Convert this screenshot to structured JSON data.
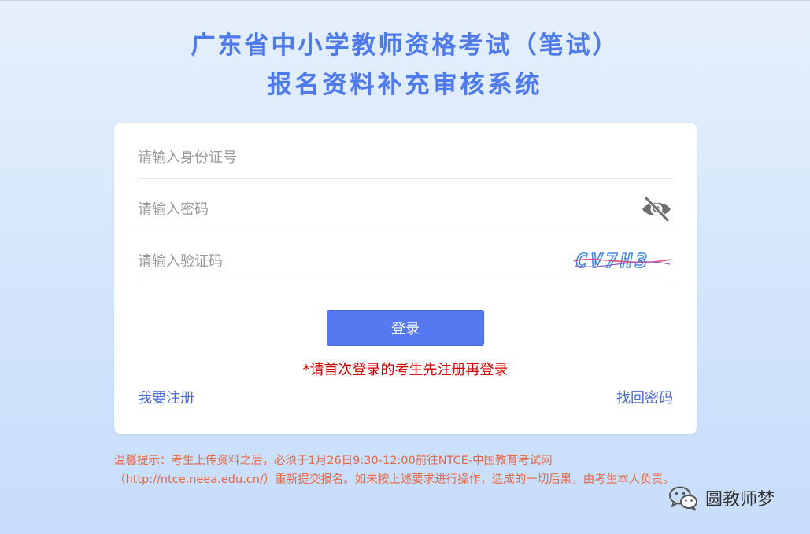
{
  "title": {
    "line1": "广东省中小学教师资格考试（笔试）",
    "line2": "报名资料补充审核系统"
  },
  "form": {
    "id_placeholder": "请输入身份证号",
    "password_placeholder": "请输入密码",
    "captcha_placeholder": "请输入验证码",
    "captcha_text": "CV7H3",
    "login_label": "登录",
    "notice": "*请首次登录的考生先注册再登录",
    "register_label": "我要注册",
    "recover_label": "找回密码"
  },
  "tip": {
    "prefix": "温馨提示：考生上传资料之后，必须于1月26日9:30-12:00前往NTCE-中国教育考试网（",
    "url": "http://ntce.neea.edu.cn/",
    "suffix": "）重新提交报名。如未按上述要求进行操作，造成的一切后果，由考生本人负责。"
  },
  "watermark": {
    "text": "圆教师梦",
    "icon": "wechat-icon"
  },
  "colors": {
    "title": "#4f7bea",
    "button": "#5678f0",
    "notice": "#d40000",
    "link": "#4a6ad8",
    "tip": "#e56a4b"
  },
  "icons": {
    "password_toggle": "eye-slash-icon"
  }
}
